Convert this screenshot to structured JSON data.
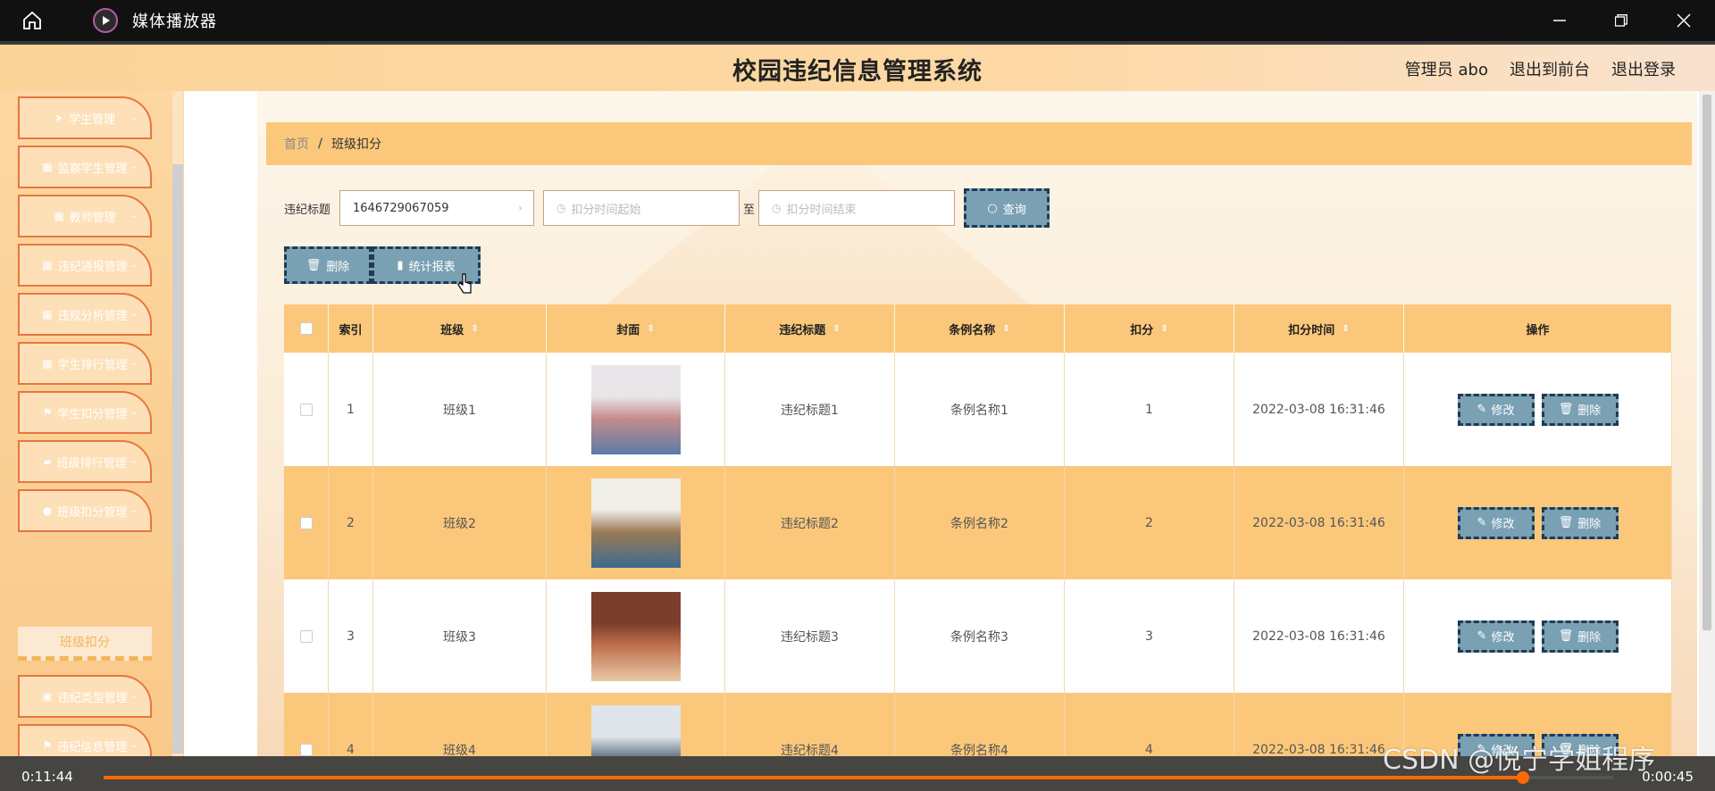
{
  "player": {
    "title": "媒体播放器",
    "time_elapsed": "0:11:44",
    "time_remaining": "0:00:45",
    "progress_fraction": 0.94,
    "accent": "#ff6a00"
  },
  "watermark": "CSDN @悦宁学姐程序",
  "app": {
    "title": "校园违纪信息管理系统",
    "user_label": "管理员 abo",
    "back_front_label": "退出到前台",
    "logout_label": "退出登录"
  },
  "sidebar": {
    "items": [
      {
        "label": "学生管理",
        "icon": "send-icon",
        "glyph": "➤"
      },
      {
        "label": "监察学生管理",
        "icon": "grid-icon",
        "glyph": "▦"
      },
      {
        "label": "教师管理",
        "icon": "grid-icon",
        "glyph": "▦"
      },
      {
        "label": "违纪通报管理",
        "icon": "grid-icon",
        "glyph": "▦"
      },
      {
        "label": "违规分析管理",
        "icon": "grid-icon",
        "glyph": "▦"
      },
      {
        "label": "学生排行管理",
        "icon": "grid-icon",
        "glyph": "▦"
      },
      {
        "label": "学生扣分管理",
        "icon": "flag-icon",
        "glyph": "⚑"
      },
      {
        "label": "班级排行管理",
        "icon": "thumb-icon",
        "glyph": "▰"
      },
      {
        "label": "班级扣分管理",
        "icon": "pin-icon",
        "glyph": "●"
      },
      {
        "label": "违纪类型管理",
        "icon": "clipboard-icon",
        "glyph": "▣"
      },
      {
        "label": "违纪信息管理",
        "icon": "flag-icon",
        "glyph": "⚑"
      }
    ],
    "active_sub": "班级扣分"
  },
  "breadcrumb": {
    "home": "首页",
    "separator": "/",
    "current": "班级扣分"
  },
  "search": {
    "title_label": "违纪标题",
    "title_value": "1646729067059",
    "start_placeholder": "扣分时间起始",
    "to_label": "至",
    "end_placeholder": "扣分时间结束",
    "query_label": "查询"
  },
  "actions": {
    "delete_label": "删除",
    "report_label": "统计报表"
  },
  "table": {
    "columns": [
      "索引",
      "班级",
      "封面",
      "违纪标题",
      "条例名称",
      "扣分",
      "扣分时间",
      "操作"
    ],
    "edit_label": "修改",
    "delete_label": "删除",
    "rows": [
      {
        "index": "1",
        "class": "班级1",
        "title": "违纪标题1",
        "rule": "条例名称1",
        "points": "1",
        "time": "2022-03-08 16:31:46"
      },
      {
        "index": "2",
        "class": "班级2",
        "title": "违纪标题2",
        "rule": "条例名称2",
        "points": "2",
        "time": "2022-03-08 16:31:46"
      },
      {
        "index": "3",
        "class": "班级3",
        "title": "违纪标题3",
        "rule": "条例名称3",
        "points": "3",
        "time": "2022-03-08 16:31:46"
      },
      {
        "index": "4",
        "class": "班级4",
        "title": "违纪标题4",
        "rule": "条例名称4",
        "points": "4",
        "time": "2022-03-08 16:31:46"
      }
    ]
  }
}
